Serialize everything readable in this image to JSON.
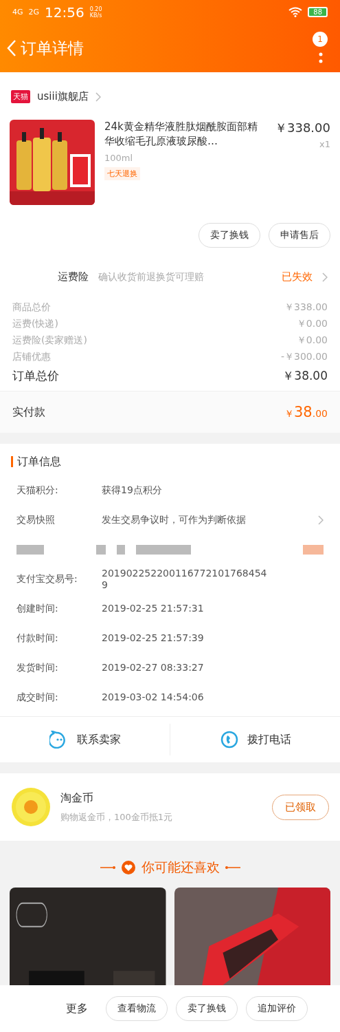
{
  "status_bar": {
    "network_1": "4G",
    "network_2": "2G",
    "time": "12:56",
    "speed": "0.20",
    "speed_unit": "KB/s",
    "battery": "88"
  },
  "header": {
    "title": "订单详情",
    "badge": "1"
  },
  "shop": {
    "name": "usiii旗舰店",
    "badge": "天猫"
  },
  "product": {
    "kind": "picture",
    "title": "24k黄金精华液胜肽烟酰胺面部精华收缩毛孔原液玻尿酸…",
    "sku": "100ml",
    "tag": "七天退换",
    "price": "￥338.00",
    "qty": "x1"
  },
  "product_actions": [
    "卖了换钱",
    "申请售后"
  ],
  "insurance": {
    "label": "运费险",
    "desc": "确认收货前退换货可理赔",
    "status": "已失效"
  },
  "price_rows": [
    {
      "label": "商品总价",
      "value": "￥338.00"
    },
    {
      "label": "运费(快递)",
      "value": "￥0.00"
    },
    {
      "label": "运费险(卖家赠送)",
      "value": "￥0.00"
    },
    {
      "label": "店铺优惠",
      "value": "-￥300.00"
    }
  ],
  "order_total": {
    "label": "订单总价",
    "value": "￥38.00"
  },
  "paid": {
    "label": "实付款",
    "currency": "￥",
    "amount": "38",
    "cents": ".00"
  },
  "order_info": {
    "title": "订单信息",
    "rows": [
      {
        "kind": "text",
        "label": "天猫积分:",
        "value": "获得19点积分"
      },
      {
        "kind": "link",
        "label": "交易快照",
        "value": "发生交易争议时，可作为判断依据"
      },
      {
        "kind": "redacted"
      },
      {
        "kind": "text",
        "label": "支付宝交易号:",
        "value": "2019022522001167721017684549"
      },
      {
        "kind": "text",
        "label": "创建时间:",
        "value": "2019-02-25 21:57:31"
      },
      {
        "kind": "text",
        "label": "付款时间:",
        "value": "2019-02-25 21:57:39"
      },
      {
        "kind": "text",
        "label": "发货时间:",
        "value": "2019-02-27 08:33:27"
      },
      {
        "kind": "text",
        "label": "成交时间:",
        "value": "2019-03-02 14:54:06"
      }
    ]
  },
  "contact": [
    {
      "kind": "chat",
      "label": "联系卖家"
    },
    {
      "kind": "phone",
      "label": "拨打电话"
    }
  ],
  "coins": {
    "title": "淘金币",
    "desc": "购物返金币，100金币抵1元",
    "button": "已领取"
  },
  "recommend": {
    "title": "你可能还喜欢"
  },
  "bottom_bar": {
    "more": "更多",
    "buttons": [
      "查看物流",
      "卖了换钱",
      "追加评价"
    ]
  }
}
